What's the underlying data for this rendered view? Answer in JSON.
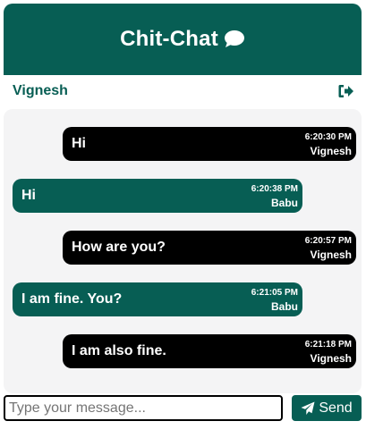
{
  "header": {
    "title": "Chit-Chat",
    "icon": "chat-bubble-icon"
  },
  "user": {
    "name": "Vignesh",
    "logout_icon": "sign-out-icon"
  },
  "messages": [
    {
      "text": "Hi",
      "time": "6:20:30 PM",
      "sender": "Vignesh"
    },
    {
      "text": "Hi",
      "time": "6:20:38 PM",
      "sender": "Babu"
    },
    {
      "text": "How are you?",
      "time": "6:20:57 PM",
      "sender": "Vignesh"
    },
    {
      "text": "I am fine. You?",
      "time": "6:21:05 PM",
      "sender": "Babu"
    },
    {
      "text": "I am also fine.",
      "time": "6:21:18 PM",
      "sender": "Vignesh"
    }
  ],
  "composer": {
    "placeholder": "Type your message...",
    "send_label": "Send",
    "send_icon": "paper-plane-icon"
  },
  "colors": {
    "primary": "#075e54",
    "sent_bubble": "#000000",
    "chat_background": "#f4f4f5"
  }
}
